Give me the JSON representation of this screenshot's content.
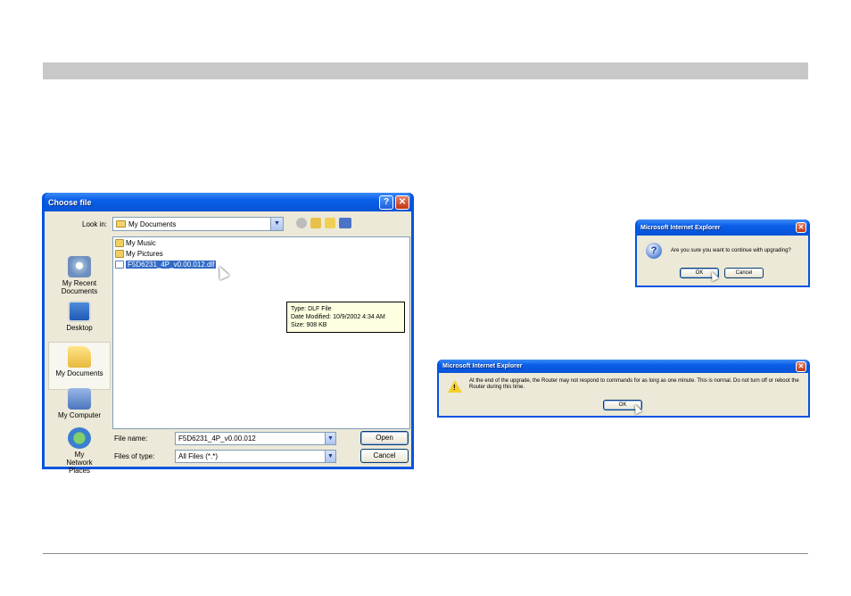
{
  "choose_dialog": {
    "title": "Choose file",
    "help_glyph": "?",
    "close_glyph": "✕",
    "look_in_label": "Look in:",
    "look_in_value": "My Documents",
    "toolbar_icons": [
      "back-icon",
      "up-folder-icon",
      "new-folder-icon",
      "view-menu-icon"
    ],
    "places": [
      {
        "label": "My Recent Documents",
        "icon": "recent-documents-icon"
      },
      {
        "label": "Desktop",
        "icon": "desktop-icon"
      },
      {
        "label": "My Documents",
        "icon": "my-documents-icon"
      },
      {
        "label": "My Computer",
        "icon": "my-computer-icon"
      },
      {
        "label": "My Network Places",
        "icon": "network-places-icon"
      }
    ],
    "files": [
      {
        "name": "My Music",
        "icon": "folder-icon"
      },
      {
        "name": "My Pictures",
        "icon": "folder-icon"
      },
      {
        "name": "F5D6231_4P_v0.00.012.dlf",
        "icon": "file-icon"
      }
    ],
    "tooltip": {
      "type": "Type: DLF File",
      "modified": "Date Modified: 10/9/2002 4:34 AM",
      "size": "Size: 908 KB"
    },
    "file_name_label": "File name:",
    "file_name_value": "F5D6231_4P_v0.00.012",
    "files_of_type_label": "Files of type:",
    "files_of_type_value": "All Files (*.*)",
    "open_label": "Open",
    "cancel_label": "Cancel"
  },
  "confirm_dialog": {
    "title": "Microsoft Internet Explorer",
    "close_glyph": "✕",
    "message": "Are you sure you want to continue with upgrading?",
    "ok_label": "OK",
    "cancel_label": "Cancel"
  },
  "notice_dialog": {
    "title": "Microsoft Internet Explorer",
    "close_glyph": "✕",
    "message": "At the end of the upgrade, the Router may not respond to commands for as long as one minute. This is normal. Do not turn off or reboot the Router during this time.",
    "ok_label": "OK"
  }
}
